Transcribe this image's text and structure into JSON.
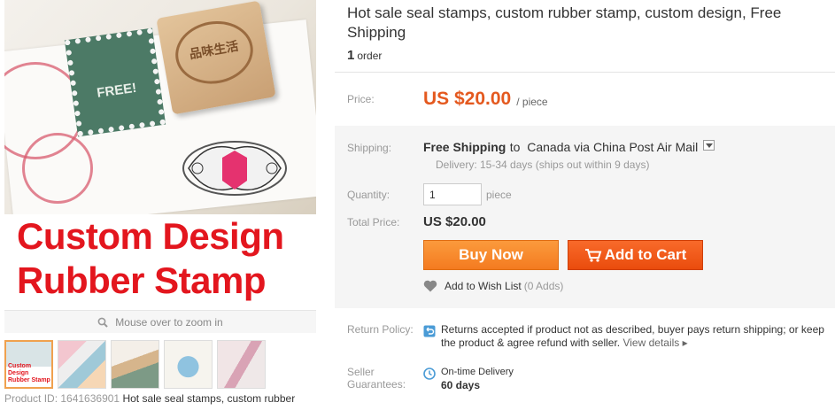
{
  "gallery": {
    "banner_line1": "Custom Design",
    "banner_line2": "Rubber Stamp",
    "zoom_hint": "Mouse over to zoom in",
    "thumb1_line1": "Custom Design",
    "thumb1_line2": "Rubber Stamp",
    "product_id_label": "Product ID: 1641636901",
    "product_id_title": "Hot sale seal stamps, custom rubber"
  },
  "product": {
    "title": "Hot sale seal stamps, custom rubber stamp, custom design, Free Shipping",
    "order_count": "1",
    "order_label": "order"
  },
  "price": {
    "label": "Price:",
    "value": "US $20.00",
    "unit": "/ piece"
  },
  "shipping": {
    "label": "Shipping:",
    "method": "Free Shipping",
    "destination": "to  Canada via China Post Air Mail",
    "delivery": "Delivery: 15-34 days (ships out within 9 days)"
  },
  "quantity": {
    "label": "Quantity:",
    "value": "1",
    "unit": "piece"
  },
  "total": {
    "label": "Total Price:",
    "value": "US $20.00"
  },
  "buttons": {
    "buy_now": "Buy Now",
    "add_to_cart": "Add to Cart"
  },
  "wishlist": {
    "label": "Add to Wish List",
    "count": "(0 Adds)"
  },
  "policy": {
    "label": "Return Policy:",
    "text": "Returns accepted if product not as described, buyer pays return shipping; or keep the product & agree refund with seller.",
    "link": "View details ▸"
  },
  "guarantees": {
    "label": "Seller Guarantees:",
    "line1": "On-time Delivery",
    "line2": "60 days"
  },
  "colors": {
    "price": "#e4591f",
    "buy_now": "#f47b20",
    "add_to_cart": "#ea4c0d",
    "banner_red": "#e3161e"
  }
}
